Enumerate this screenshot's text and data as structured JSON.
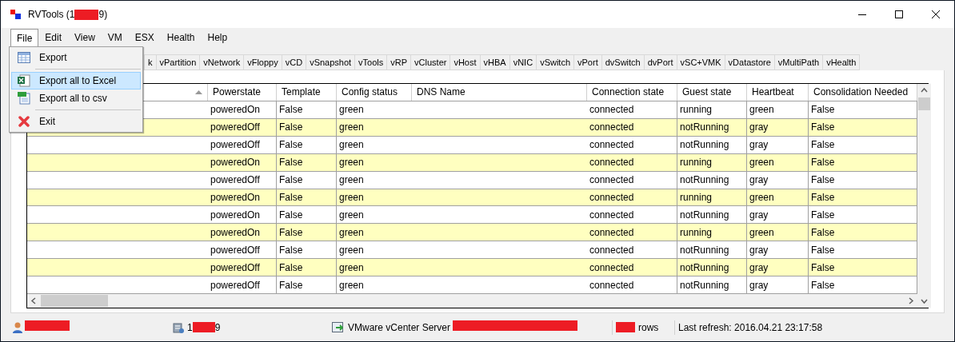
{
  "window": {
    "title_start": "RVTools (1",
    "title_end": "9)"
  },
  "menu_bar": [
    {
      "label": "File",
      "selected": true
    },
    {
      "label": "Edit",
      "selected": false
    },
    {
      "label": "View",
      "selected": false
    },
    {
      "label": "VM",
      "selected": false
    },
    {
      "label": "ESX",
      "selected": false
    },
    {
      "label": "Health",
      "selected": false
    },
    {
      "label": "Help",
      "selected": false
    }
  ],
  "file_menu": [
    {
      "kind": "item",
      "label": "Export",
      "selected": false
    },
    {
      "kind": "separator"
    },
    {
      "kind": "item",
      "label": "Export all to Excel",
      "selected": true
    },
    {
      "kind": "item",
      "label": "Export all to csv",
      "selected": false
    },
    {
      "kind": "separator"
    },
    {
      "kind": "item",
      "label": "Exit",
      "selected": false
    }
  ],
  "tabs": [
    "k",
    "vPartition",
    "vNetwork",
    "vFloppy",
    "vCD",
    "vSnapshot",
    "vTools",
    "vRP",
    "vCluster",
    "vHost",
    "vHBA",
    "vNIC",
    "vSwitch",
    "vPort",
    "dvSwitch",
    "dvPort",
    "vSC+VMK",
    "vDatastore",
    "vMultiPath",
    "vHealth"
  ],
  "table": {
    "columns": [
      "",
      "Powerstate",
      "Template",
      "Config status",
      "DNS Name",
      "Connection state",
      "Guest state",
      "Heartbeat",
      "Consolidation Needed"
    ],
    "rows": [
      [
        "",
        "poweredOn",
        "False",
        "green",
        "",
        "connected",
        "running",
        "green",
        "False"
      ],
      [
        "",
        "poweredOff",
        "False",
        "green",
        "",
        "connected",
        "notRunning",
        "gray",
        "False"
      ],
      [
        "",
        "poweredOff",
        "False",
        "green",
        "",
        "connected",
        "notRunning",
        "gray",
        "False"
      ],
      [
        "",
        "poweredOn",
        "False",
        "green",
        "",
        "connected",
        "running",
        "green",
        "False"
      ],
      [
        "",
        "poweredOff",
        "False",
        "green",
        "",
        "connected",
        "notRunning",
        "gray",
        "False"
      ],
      [
        "",
        "poweredOn",
        "False",
        "green",
        "",
        "connected",
        "running",
        "green",
        "False"
      ],
      [
        "",
        "poweredOn",
        "False",
        "green",
        "",
        "connected",
        "notRunning",
        "gray",
        "False"
      ],
      [
        "",
        "poweredOn",
        "False",
        "green",
        "",
        "connected",
        "running",
        "green",
        "False"
      ],
      [
        "",
        "poweredOff",
        "False",
        "green",
        "",
        "connected",
        "notRunning",
        "gray",
        "False"
      ],
      [
        "",
        "poweredOff",
        "False",
        "green",
        "",
        "connected",
        "notRunning",
        "gray",
        "False"
      ],
      [
        "",
        "poweredOff",
        "False",
        "green",
        "",
        "connected",
        "notRunning",
        "gray",
        "False"
      ]
    ]
  },
  "status_bar": {
    "host_start": "1",
    "host_end": "9",
    "server": "VMware vCenter Server",
    "rows": "rows",
    "last_refresh": "Last refresh: 2016.04.21 23:17:58"
  }
}
